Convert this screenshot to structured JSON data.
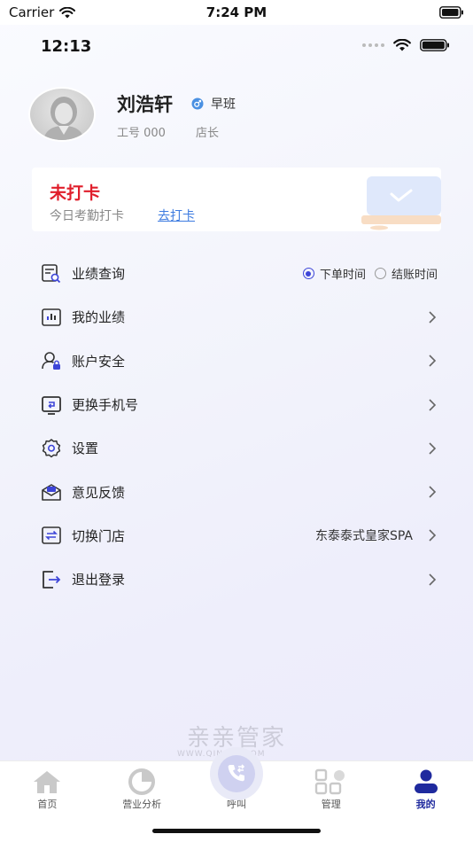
{
  "system_status": {
    "carrier": "Carrier",
    "time": "7:24 PM"
  },
  "inner_status": {
    "time": "12:13"
  },
  "profile": {
    "name": "刘浩轩",
    "shift": "早班",
    "employee_no": "工号 000",
    "role": "店长"
  },
  "checkin": {
    "status": "未打卡",
    "subtitle": "今日考勤打卡",
    "action": "去打卡",
    "status_color": "#e01e2b"
  },
  "menu": {
    "items": [
      {
        "label": "业绩查询",
        "icon": "performance-query-icon",
        "options": [
          "下单时间",
          "结账时间"
        ],
        "selected": "下单时间"
      },
      {
        "label": "我的业绩",
        "icon": "bar-chart-icon"
      },
      {
        "label": "账户安全",
        "icon": "user-lock-icon"
      },
      {
        "label": "更换手机号",
        "icon": "phone-swap-icon"
      },
      {
        "label": "设置",
        "icon": "gear-icon"
      },
      {
        "label": "意见反馈",
        "icon": "feedback-icon"
      },
      {
        "label": "切换门店",
        "icon": "switch-store-icon",
        "value": "东泰泰式皇家SPA"
      },
      {
        "label": "退出登录",
        "icon": "logout-icon"
      }
    ]
  },
  "watermark": {
    "logo": "亲亲管家",
    "url": "WWW.QINQIN.COM"
  },
  "tabbar": {
    "tabs": [
      {
        "label": "首页",
        "icon": "home-icon"
      },
      {
        "label": "营业分析",
        "icon": "pie-chart-icon"
      },
      {
        "label": "呼叫",
        "icon": "phone-call-icon"
      },
      {
        "label": "管理",
        "icon": "grid-icon"
      },
      {
        "label": "我的",
        "icon": "person-icon"
      }
    ],
    "active": "我的",
    "accent": "#1f2a9e"
  }
}
